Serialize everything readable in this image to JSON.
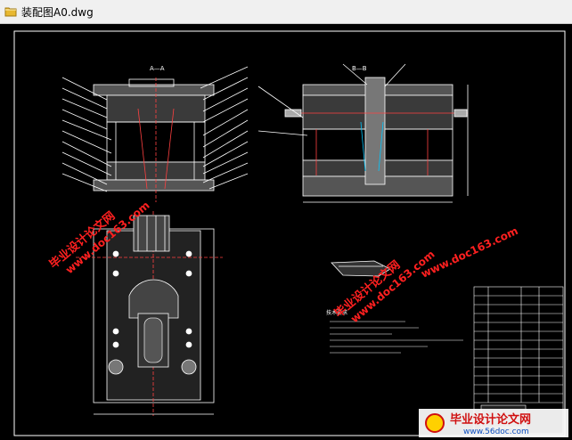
{
  "window": {
    "title": "装配图A0.dwg",
    "file_icon": "dwg-file-icon"
  },
  "drawing": {
    "section_label_a": "A—A",
    "section_label_b": "B—B",
    "watermark_site": "毕业设计论文网",
    "watermark_url": "www.doc163.com",
    "footer_logo_text": "毕业设计论文网",
    "footer_logo_url": "www.56doc.com",
    "notes_title": "技术要求"
  },
  "colors": {
    "background": "#000000",
    "line": "#ffffff",
    "dim": "#ff4040",
    "watermark": "#ff2020",
    "accent_cyan": "#00c8ff",
    "accent_yellow": "#ffd000"
  }
}
